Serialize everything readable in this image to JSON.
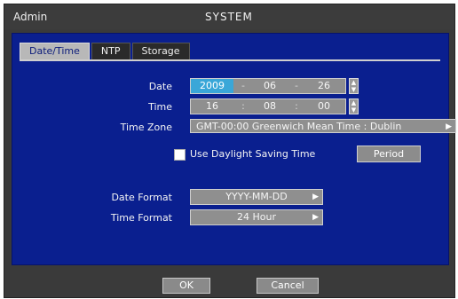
{
  "title": {
    "user": "Admin",
    "text": "SYSTEM"
  },
  "tabs": [
    {
      "label": "Date/Time",
      "active": true
    },
    {
      "label": "NTP",
      "active": false
    },
    {
      "label": "Storage",
      "active": false
    }
  ],
  "date": {
    "label": "Date",
    "year": "2009",
    "month": "06",
    "day": "26",
    "sep": "-"
  },
  "time": {
    "label": "Time",
    "hour": "16",
    "minute": "08",
    "second": "00",
    "sep": ":"
  },
  "timezone": {
    "label": "Time Zone",
    "value": "GMT-00:00 Greenwich Mean Time : Dublin"
  },
  "dst": {
    "label": "Use Daylight Saving Time",
    "checked": false,
    "period_button": "Period"
  },
  "date_format": {
    "label": "Date Format",
    "value": "YYYY-MM-DD"
  },
  "time_format": {
    "label": "Time Format",
    "value": "24 Hour"
  },
  "footer": {
    "ok": "OK",
    "cancel": "Cancel"
  },
  "icons": {
    "spin": "up-down-spinner-icon",
    "dropdown": "dropdown-arrow-icon"
  },
  "colors": {
    "panel": "#0a1f8f",
    "selected": "#3aa7d8",
    "control": "#8f8f8f"
  }
}
